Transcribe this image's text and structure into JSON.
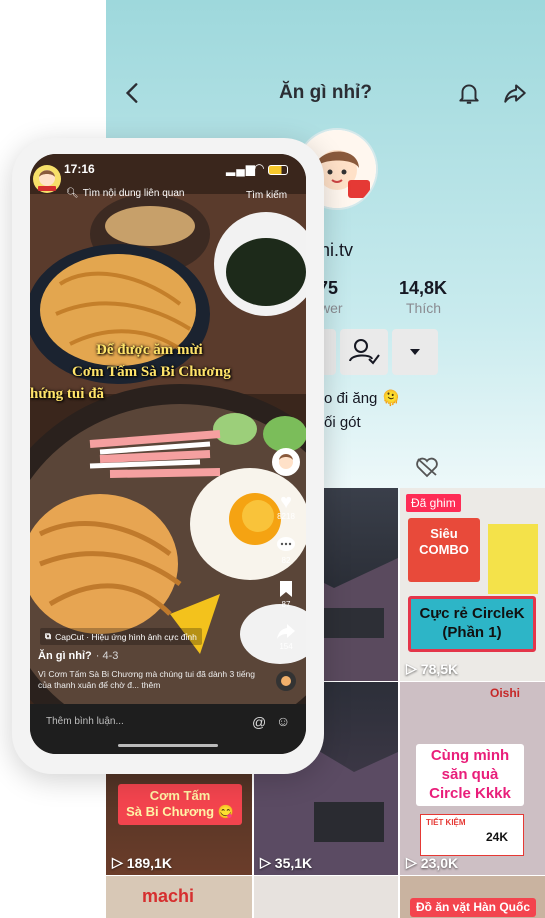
{
  "profile": {
    "title": "Ăn gì nhỉ?",
    "username_fragment": "inhi.tv",
    "stats": [
      {
        "num": "75",
        "label": "wer"
      },
      {
        "num": "14,8K",
        "label": "Thích"
      }
    ],
    "bio_line1": "o đi ăng 🫠",
    "bio_line2": "ối gót"
  },
  "grid": {
    "tiles": [
      {
        "views": "",
        "pinned": ""
      },
      {
        "views": "78,5K",
        "pinned": "Đã ghim",
        "caption": "Cực rẻ CircleK\n(Phần 1)",
        "promo": "Siêu\nCOMBO"
      },
      {
        "views": "189,1K",
        "caption": "Cơm Tấm\nSà Bi Chương 😋"
      },
      {
        "views": "35,1K"
      },
      {
        "views": "23,0K",
        "caption": "Cùng mình\nsăn quà\nCircle Kkkk",
        "save_label": "TIẾT KIỆM",
        "price": "24K",
        "brand": "Oishi"
      },
      {
        "caption": "Đồ ăn vặt Hàn Quốc",
        "brand": "machi"
      }
    ]
  },
  "video": {
    "time": "17:16",
    "search_hint": "Tìm nội dung liên quan",
    "search_btn": "Tìm kiếm",
    "overlay_line1": "Để được ăm mừi",
    "overlay_line2": "Cơm Tấm Sà Bi Chương",
    "overlay_line3": "hứng tui đã",
    "likes": "8218",
    "comments": "82",
    "saves": "87",
    "shares": "154",
    "capcut": "CapCut · Hiệu ứng hình ảnh cực đỉnh",
    "author": "Ăn gì nhỉ?",
    "date": "· 4-3",
    "desc": "Vì Cơm Tấm Sà Bi Chương mà chúng tui đã dành 3 tiếng của thanh xuân để chờ đ... thêm",
    "comment_placeholder": "Thêm bình luận..."
  },
  "colors": {
    "accent": "#fe2c55",
    "overlay_text": "#ffe46a",
    "header_bg": "#9ed8dc"
  }
}
